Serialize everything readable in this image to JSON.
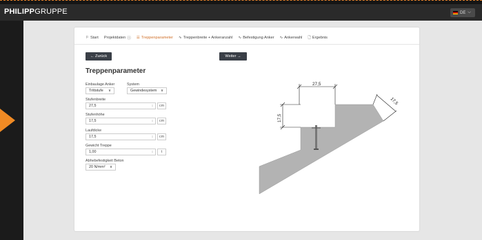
{
  "brand": {
    "bold": "PHILIPP",
    "light": "GRUPPE"
  },
  "language": {
    "code": "DE"
  },
  "tabs": [
    {
      "label": "Start",
      "icon": "flag-icon"
    },
    {
      "label": "Projektdaten",
      "icon": "",
      "suffix": "ⓘ"
    },
    {
      "label": "Treppenparameter",
      "icon": "sliders-icon",
      "active": true
    },
    {
      "label": "Treppenbreite + Ankeranzahl",
      "icon": "pulse-icon"
    },
    {
      "label": "Befestigung Anker",
      "icon": "pulse-icon"
    },
    {
      "label": "Ankerwahl",
      "icon": "pulse-icon"
    },
    {
      "label": "Ergebnis",
      "icon": "document-icon"
    }
  ],
  "buttons": {
    "back": "← Zurück",
    "next": "Weiter →"
  },
  "page_title": "Treppenparameter",
  "form": {
    "einbaulage": {
      "label": "Einbaulage Anker",
      "value": "Trittstufe"
    },
    "system": {
      "label": "System",
      "value": "Gewindesystem"
    },
    "stufenbreite": {
      "label": "Stufenbreite",
      "value": "27,5",
      "unit": "cm"
    },
    "stufenhoehe": {
      "label": "Stufenhöhe",
      "value": "17,5",
      "unit": "cm"
    },
    "laufdicke": {
      "label": "Laufdicke",
      "value": "17,5",
      "unit": "cm"
    },
    "gewicht": {
      "label": "Gewicht Treppe",
      "value": "1,00",
      "unit": "t"
    },
    "beton": {
      "label": "Abhebefestigkeit Beton",
      "value": "20 N/mm²"
    }
  },
  "diagram": {
    "dim_width": "27,5",
    "dim_height": "17,5",
    "dim_thickness": "17,5",
    "colors": {
      "concrete": "#b3b3b3",
      "lines": "#222222"
    }
  },
  "colors": {
    "accent": "#d1702a",
    "arrow": "#f08a24",
    "button": "#3a3f47"
  }
}
